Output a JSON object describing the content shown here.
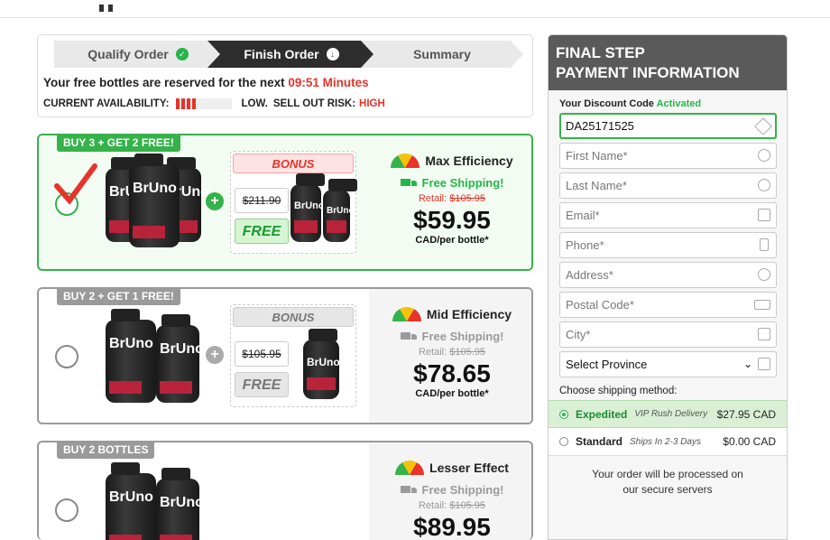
{
  "steps": [
    {
      "label": "Qualify Order",
      "icon": "check-circle-icon"
    },
    {
      "label": "Finish Order",
      "icon": "arrow-down-circle-icon"
    },
    {
      "label": "Summary"
    }
  ],
  "reservation": {
    "text": "Your free bottles are reserved for the next",
    "timer": "09:51 Minutes"
  },
  "availability": {
    "label": "CURRENT AVAILABILITY:",
    "low": "LOW.",
    "risk_label": "SELL OUT RISK:",
    "risk": "HIGH"
  },
  "offers": [
    {
      "tag": "BUY 3 + GET 2 FREE!",
      "bottle_label": "BrUno",
      "bonus": "BONUS",
      "bonus_old_price": "$211.90",
      "bonus_free": "FREE",
      "efficiency": "Max Efficiency",
      "shipping": "Free Shipping!",
      "retail_label": "Retail:",
      "retail_price": "$105.95",
      "price": "$59.95",
      "per": "CAD/per bottle*"
    },
    {
      "tag": "BUY 2 + GET 1 FREE!",
      "bottle_label": "BrUno",
      "bonus": "BONUS",
      "bonus_old_price": "$105.95",
      "bonus_free": "FREE",
      "efficiency": "Mid Efficiency",
      "shipping": "Free Shipping!",
      "retail_label": "Retail:",
      "retail_price": "$105.95",
      "price": "$78.65",
      "per": "CAD/per bottle*"
    },
    {
      "tag": "BUY 2 BOTTLES",
      "bottle_label": "BrUno",
      "efficiency": "Lesser Effect",
      "shipping": "Free Shipping!",
      "retail_label": "Retail:",
      "retail_price": "$105.95",
      "price": "$89.95"
    }
  ],
  "payment": {
    "title_line1": "FINAL STEP",
    "title_line2": "PAYMENT INFORMATION",
    "discount_label": "Your Discount Code",
    "discount_status": "Activated",
    "discount_code": "DA25171525",
    "first_name_placeholder": "First Name*",
    "last_name_placeholder": "Last Name*",
    "email_placeholder": "Email*",
    "phone_placeholder": "Phone*",
    "address_placeholder": "Address*",
    "postal_placeholder": "Postal Code*",
    "city_placeholder": "City*",
    "province_selected": "Select Province",
    "shipping_method_label": "Choose shipping method:",
    "shipping_options": [
      {
        "name": "Expedited",
        "desc": "VIP Rush Delivery",
        "price": "$27.95 CAD"
      },
      {
        "name": "Standard",
        "desc": "Ships In 2-3 Days",
        "price": "$0.00 CAD"
      }
    ],
    "secure_line1": "Your order will be processed on",
    "secure_line2": "our secure servers"
  },
  "colors": {
    "accent_green": "#35b24a",
    "alert_red": "#e8332a",
    "dark": "#2d2d2d"
  }
}
